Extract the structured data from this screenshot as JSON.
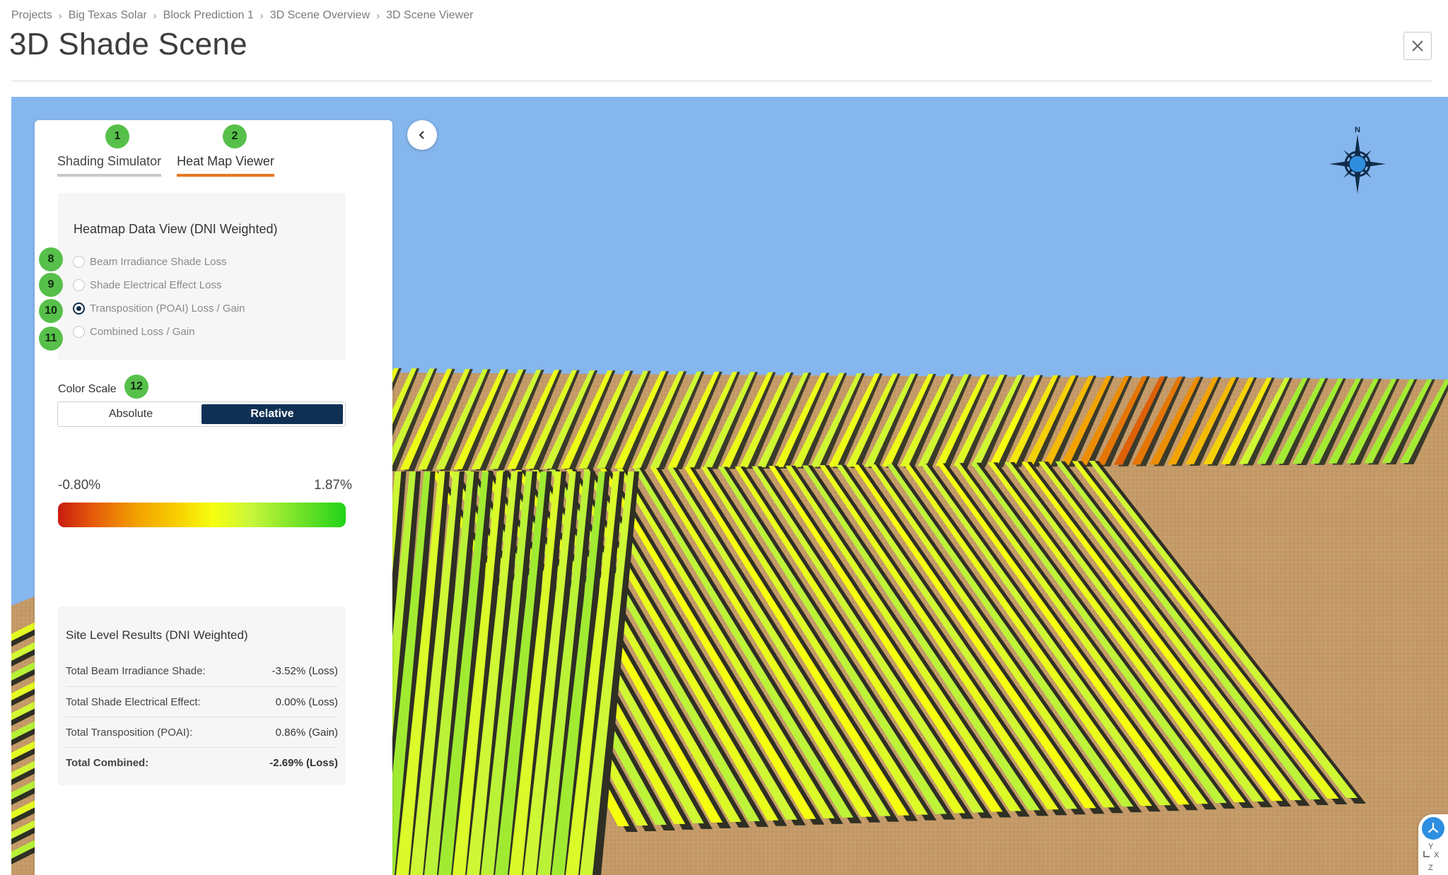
{
  "breadcrumb": [
    "Projects",
    "Big Texas Solar",
    "Block Prediction 1",
    "3D Scene Overview",
    "3D Scene Viewer"
  ],
  "page": {
    "title": "3D Shade Scene"
  },
  "tabs": [
    {
      "label": "Shading Simulator",
      "badge": "1",
      "active": false
    },
    {
      "label": "Heat Map Viewer",
      "badge": "2",
      "active": true
    }
  ],
  "heatmap": {
    "title": "Heatmap Data View (DNI Weighted)",
    "options": [
      {
        "label": "Beam Irradiance Shade Loss",
        "badge": "8",
        "checked": false
      },
      {
        "label": "Shade Electrical Effect Loss",
        "badge": "9",
        "checked": false
      },
      {
        "label": "Transposition (POAI) Loss / Gain",
        "badge": "10",
        "checked": true
      },
      {
        "label": "Combined Loss / Gain",
        "badge": "11",
        "checked": false
      }
    ]
  },
  "color_scale": {
    "label": "Color Scale",
    "badge": "12",
    "options": [
      "Absolute",
      "Relative"
    ],
    "selected": "Relative",
    "min": "-0.80%",
    "max": "1.87%"
  },
  "site_results": {
    "title": "Site Level Results (DNI Weighted)",
    "rows": [
      {
        "label": "Total Beam Irradiance Shade:",
        "value": "-3.52% (Loss)",
        "bold": false
      },
      {
        "label": "Total Shade Electrical Effect:",
        "value": "0.00% (Loss)",
        "bold": false
      },
      {
        "label": "Total Transposition (POAI):",
        "value": "0.86% (Gain)",
        "bold": false
      },
      {
        "label": "Total Combined:",
        "value": "-2.69% (Loss)",
        "bold": true
      }
    ]
  },
  "compass": {
    "north_label": "N"
  },
  "axis_widget": {
    "y_label": "Y",
    "x_label": "X",
    "z_label": "Z"
  },
  "colors": {
    "accent_tab": "#e87722",
    "selected_button": "#0f3054",
    "badge": "#57c04a",
    "sky": "#85b6ee",
    "ground": "#c49a68"
  }
}
